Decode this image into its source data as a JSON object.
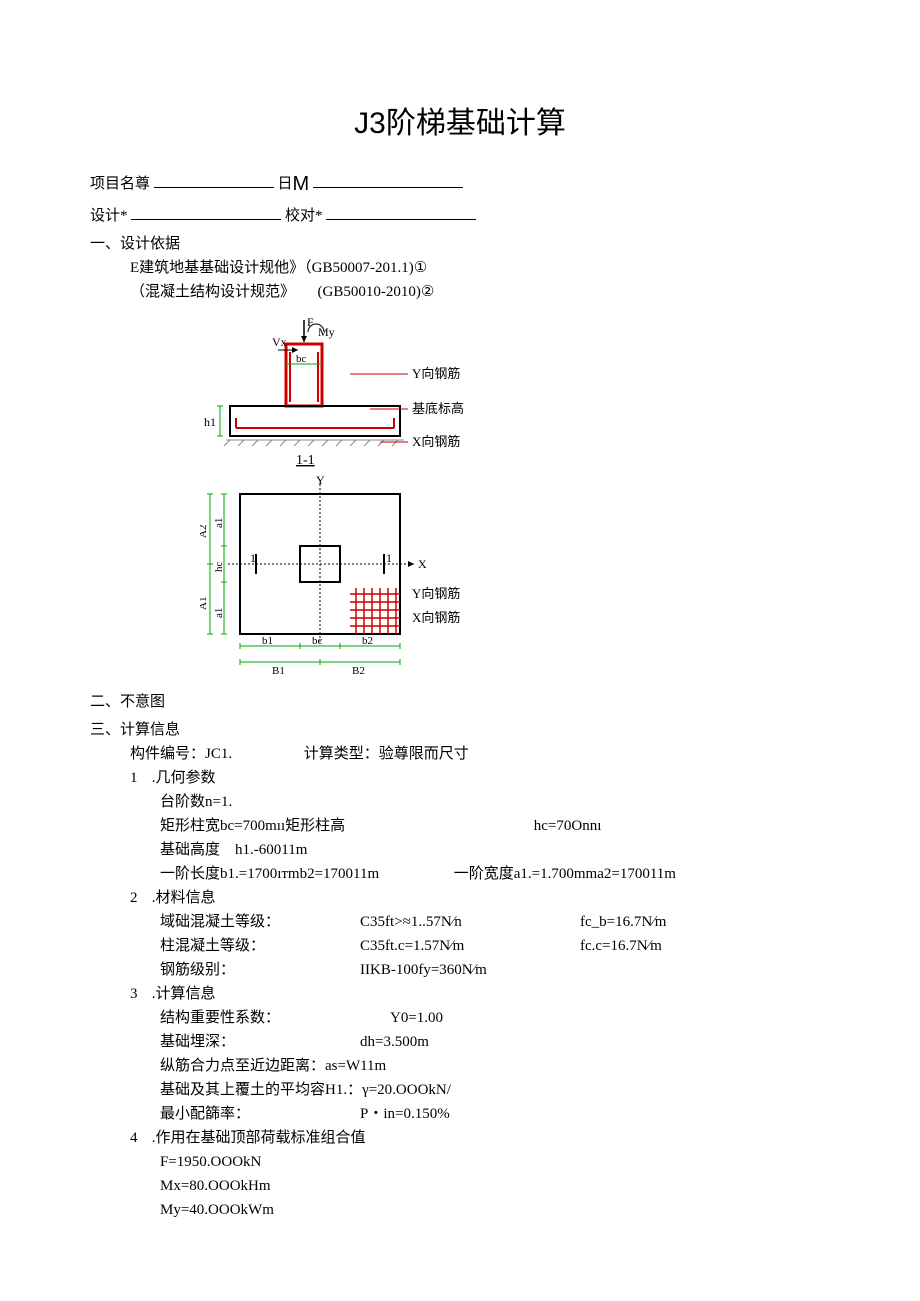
{
  "title_prefix": "J3",
  "title_rest": "阶梯基础计算",
  "meta": {
    "project_label": "项目名尊",
    "date_glyph": "日",
    "design_label": "设计*",
    "check_label": "校对*"
  },
  "sec1": {
    "heading": "一、设计依据",
    "line1": "E建筑地基基础设计规他》（GB50007-201.1)①",
    "line2": "（混凝土结构设计规范》　　(GB50010-2010)②"
  },
  "diagram_labels": {
    "f": "F",
    "my": "My",
    "vx": "Vx",
    "bc_top": "bc",
    "y_rebar": "Y向钢筋",
    "base_mark": "基底标高",
    "x_rebar": "X向钢筋",
    "sec11": "1-1",
    "y_axis": "Y",
    "x_axis": "X",
    "one_left": "1",
    "one_right": "1",
    "h1": "h1",
    "a2cap": "A2",
    "a1cap": "A1",
    "a1low": "a1",
    "a1low2": "a1",
    "hc": "hc",
    "b1": "b1",
    "bc_bot": "bc",
    "b1cap": "B1",
    "b2": "b2",
    "b2cap": "B2",
    "y_rebar2": "Y向钢筋",
    "x_rebar2": "X向钢筋"
  },
  "sec2": {
    "heading": "二、不意图"
  },
  "sec3": {
    "heading": "三、计算信息",
    "comp_line_a": "构件编号：JC1.",
    "comp_line_b": "计算类型：验尊限而尺寸",
    "g1": {
      "num": "1",
      "title": ".几何参数",
      "l1": "台阶数n=1.",
      "l2a": "矩形柱宽bc=700mıı矩形柱高",
      "l2b": "hc=70Onnı",
      "l3": "基础高度　h1.-60011m",
      "l4a": "一阶长度b1.=1700ıтmb2=170011m",
      "l4b": "一阶宽度a1.=1.700mma2=170011m"
    },
    "g2": {
      "num": "2",
      "title": ".材料信息",
      "r1a": "域础混凝土等级：",
      "r1b": "C35ft>≈1..57N∕n",
      "r1c": "fc_b=16.7N∕m",
      "r2a": "柱混凝土等级：",
      "r2b": "C35ft.c=1.57N∕m",
      "r2c": "fc.c=16.7N∕m",
      "r3a": "钢筋级别：",
      "r3b": "IIKB-100fy=360N∕m"
    },
    "g3": {
      "num": "3",
      "title": ".计算信息",
      "r1a": "结构重要性系数：",
      "r1b": "Y0=1.00",
      "r2a": "基础埋深：",
      "r2b": "dh=3.500m",
      "r3": "纵筋合力点至近边距离：as=W11m",
      "r4": "基础及其上覆土的平均容H1.：γ=20.OOOkN/",
      "r5a": "最小配篩率：",
      "r5b": "P・in=0.150%"
    },
    "g4": {
      "num": "4",
      "title": ".作用在基础顶部荷载标准组合值",
      "l1": "F=1950.OOOkN",
      "l2": "Mx=80.OOOkHm",
      "l3": "My=40.OOOkWm"
    }
  }
}
